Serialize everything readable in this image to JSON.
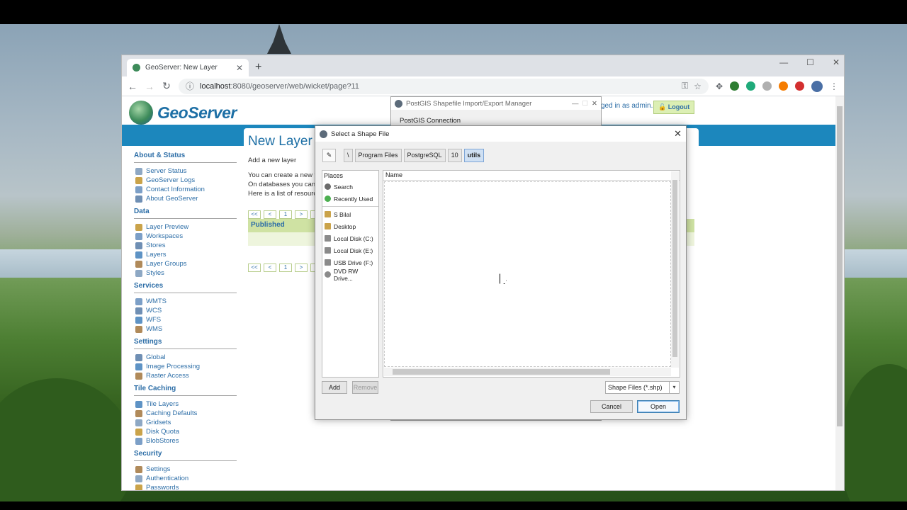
{
  "browser": {
    "tab_title": "GeoServer: New Layer",
    "new_tab_icon": "+",
    "url_host": "localhost",
    "url_rest": ":8080/geoserver/web/wicket/page?11"
  },
  "geoserver": {
    "logo_text": "GeoServer",
    "logged_in_text": "ged in as admin.",
    "logout_label": "Logout",
    "sidebar": {
      "sections": [
        {
          "title": "About & Status",
          "items": [
            "Server Status",
            "GeoServer Logs",
            "Contact Information",
            "About GeoServer"
          ]
        },
        {
          "title": "Data",
          "items": [
            "Layer Preview",
            "Workspaces",
            "Stores",
            "Layers",
            "Layer Groups",
            "Styles"
          ]
        },
        {
          "title": "Services",
          "items": [
            "WMTS",
            "WCS",
            "WFS",
            "WMS"
          ]
        },
        {
          "title": "Settings",
          "items": [
            "Global",
            "Image Processing",
            "Raster Access"
          ]
        },
        {
          "title": "Tile Caching",
          "items": [
            "Tile Layers",
            "Caching Defaults",
            "Gridsets",
            "Disk Quota",
            "BlobStores"
          ]
        },
        {
          "title": "Security",
          "items": [
            "Settings",
            "Authentication",
            "Passwords"
          ]
        }
      ]
    },
    "content": {
      "title": "New Layer",
      "subtitle": "Add a new layer",
      "line1": "You can create a new fe",
      "line2": "On databases you can al",
      "line3": "Here is a list of resource",
      "pager": {
        "first": "<<",
        "prev": "<",
        "page": "1",
        "next": ">",
        "last": ">"
      },
      "table_header": "Published"
    }
  },
  "postgis_dialog": {
    "title": "PostGIS Shapefile Import/Export Manager",
    "group_label": "PostGIS Connection"
  },
  "shape_dialog": {
    "title": "Select a Shape File",
    "breadcrumbs": [
      "\\",
      "Program Files",
      "PostgreSQL",
      "10",
      "utils"
    ],
    "places_header": "Places",
    "places_top": [
      "Search",
      "Recently Used"
    ],
    "places_drives": [
      "S Bilal",
      "Desktop",
      "Local Disk (C:)",
      "Local Disk (E:)",
      "USB Drive (F:)",
      "DVD RW Drive..."
    ],
    "name_column": "Name",
    "add_label": "Add",
    "remove_label": "Remove",
    "filter_label": "Shape Files (*.shp)",
    "cancel_label": "Cancel",
    "open_label": "Open"
  }
}
